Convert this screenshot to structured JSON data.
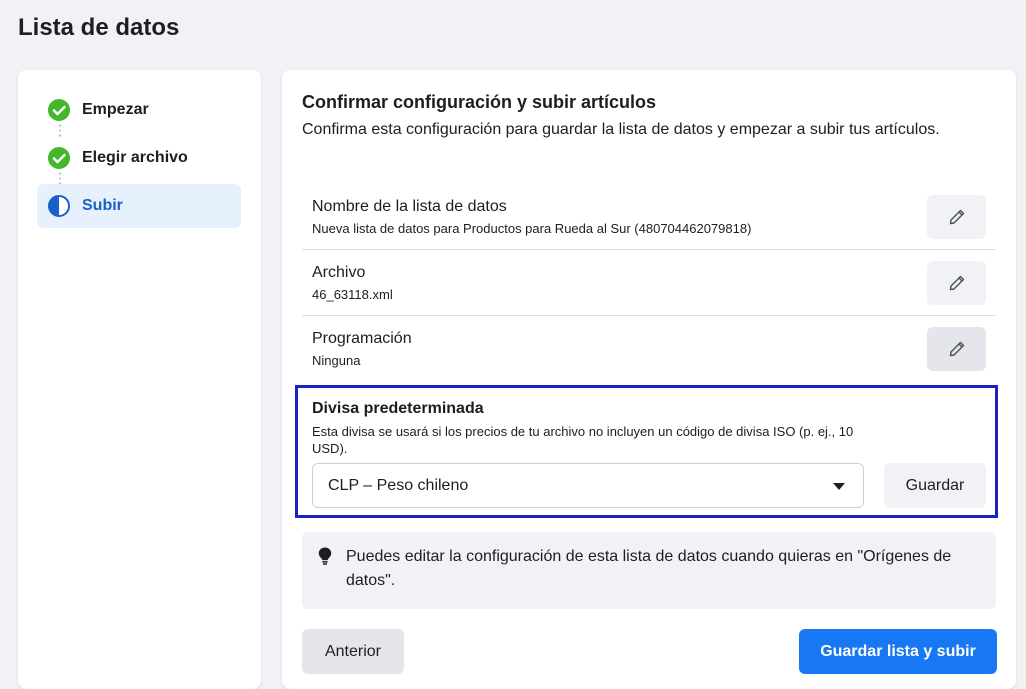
{
  "page": {
    "title": "Lista de datos"
  },
  "steps": [
    {
      "label": "Empezar",
      "status": "complete",
      "icon": "check-circle-icon"
    },
    {
      "label": "Elegir archivo",
      "status": "complete",
      "icon": "check-circle-icon"
    },
    {
      "label": "Subir",
      "status": "in-progress",
      "icon": "half-circle-icon"
    }
  ],
  "main": {
    "title": "Confirmar configuración y subir artículos",
    "subtitle": "Confirma esta configuración para guardar la lista de datos y empezar a subir tus artículos.",
    "rows": [
      {
        "label": "Nombre de la lista de datos",
        "value": "Nueva lista de datos para Productos para Rueda al Sur (480704462079818)",
        "icon": "pencil-icon"
      },
      {
        "label": "Archivo",
        "value": "46_63118.xml",
        "icon": "pencil-icon"
      },
      {
        "label": "Programación",
        "value": "Ninguna",
        "icon": "pencil-icon"
      }
    ],
    "currency": {
      "title": "Divisa predeterminada",
      "description": "Esta divisa se usará si los precios de tu archivo no incluyen un código de divisa ISO (p. ej., 10 USD).",
      "selected": "CLP – Peso chileno",
      "save_label": "Guardar"
    },
    "tip": {
      "icon": "lightbulb-icon",
      "text": "Puedes editar la configuración de esta lista de datos cuando quieras en \"Orígenes de datos\"."
    },
    "buttons": {
      "back": "Anterior",
      "primary": "Guardar lista y subir"
    }
  },
  "colors": {
    "accent": "#1877f2",
    "success": "#42b72a",
    "highlight_border": "#1a22c4",
    "active_step_bg": "#e7f0fd"
  }
}
